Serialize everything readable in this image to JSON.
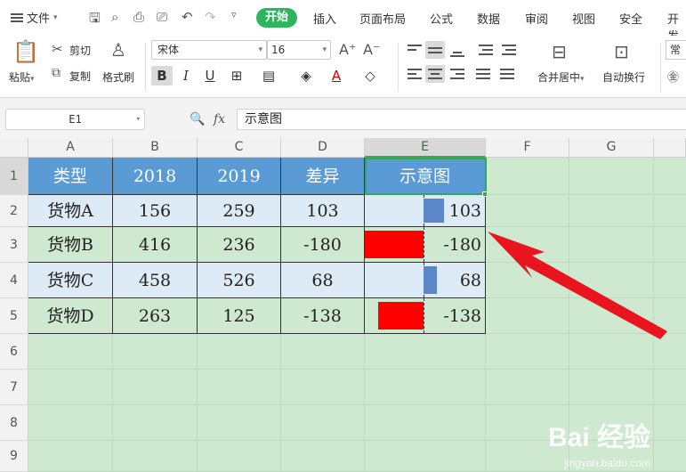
{
  "menubar": {
    "file_label": "文件",
    "tabs": [
      "开始",
      "插入",
      "页面布局",
      "公式",
      "数据",
      "审阅",
      "视图",
      "安全",
      "开发"
    ]
  },
  "ribbon": {
    "paste_label": "粘贴",
    "cut_label": "剪切",
    "copy_label": "复制",
    "format_painter_label": "格式刷",
    "font_name": "宋体",
    "font_size": "16",
    "merge_center_label": "合并居中",
    "wrap_text_label": "自动换行",
    "number_format_label": "常"
  },
  "formula_bar": {
    "cell_ref": "E1",
    "formula_value": "示意图"
  },
  "grid": {
    "column_headers": [
      "A",
      "B",
      "C",
      "D",
      "E",
      "F",
      "G"
    ],
    "row_headers": [
      "1",
      "2",
      "3",
      "4",
      "5",
      "6",
      "7",
      "8",
      "9"
    ],
    "selected_column": "E",
    "selected_row": "1"
  },
  "table": {
    "headers": [
      "类型",
      "2018",
      "2019",
      "差异",
      "示意图"
    ],
    "rows": [
      {
        "type": "货物A",
        "y2018": "156",
        "y2019": "259",
        "diff": "103",
        "bar_value": 103,
        "bar_color": "#5b87c9"
      },
      {
        "type": "货物B",
        "y2018": "416",
        "y2019": "236",
        "diff": "-180",
        "bar_value": -180,
        "bar_color": "#ff0000"
      },
      {
        "type": "货物C",
        "y2018": "458",
        "y2019": "526",
        "diff": "68",
        "bar_value": 68,
        "bar_color": "#5b87c9"
      },
      {
        "type": "货物D",
        "y2018": "263",
        "y2019": "125",
        "diff": "-138",
        "bar_value": -138,
        "bar_color": "#ff0000"
      }
    ],
    "bar_max_abs": 180
  },
  "colors": {
    "accent": "#2db55d",
    "header_fill": "#5b9bd5",
    "sheet_bg": "#cfe8d0",
    "arrow": "#e8151f"
  },
  "watermark": {
    "brand": "Bai  经验",
    "url": "jingyan.baidu.com"
  }
}
